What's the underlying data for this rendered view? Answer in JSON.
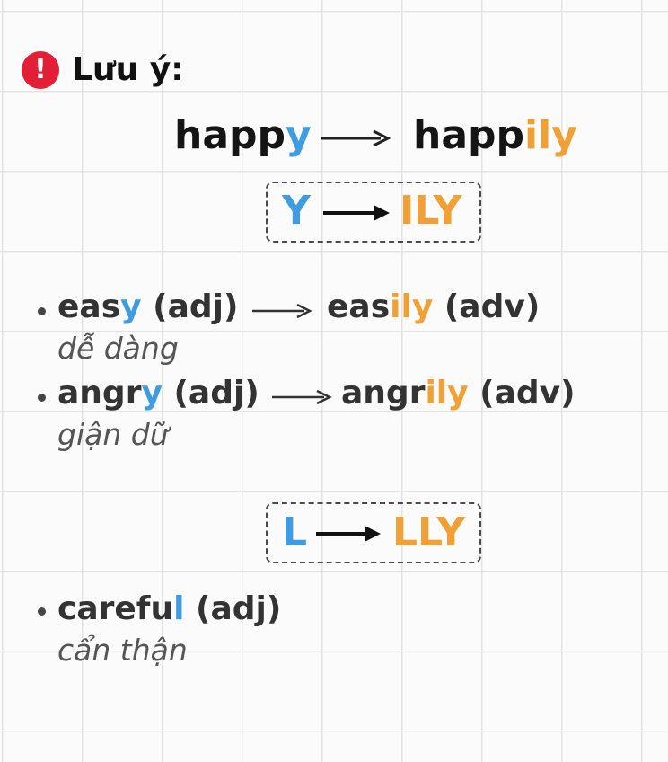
{
  "title": {
    "icon": "exclamation-icon",
    "icon_glyph": "!",
    "text": "Lưu ý:",
    "badge_color": "#e21f36"
  },
  "colors": {
    "removed": "#3f9ce0",
    "added": "#f0a035"
  },
  "main_example": {
    "from_stem": "happ",
    "from_suffix": "y",
    "to_stem": "happ",
    "to_suffix": "ily"
  },
  "rules": [
    {
      "from": "Y",
      "to": "ILY"
    },
    {
      "from": "L",
      "to": "LLY"
    }
  ],
  "examples": [
    {
      "adj_stem": "eas",
      "adj_suffix": "y",
      "adj_tag": "(adj)",
      "adv_stem": "eas",
      "adv_suffix": "ily",
      "adv_tag": "(adv)",
      "meaning": "dễ dàng"
    },
    {
      "adj_stem": "angr",
      "adj_suffix": "y",
      "adj_tag": "(adj)",
      "adv_stem": "angr",
      "adv_suffix": "ily",
      "adv_tag": "(adv)",
      "meaning": "giận dữ"
    },
    {
      "adj_stem": "carefu",
      "adj_suffix": "l",
      "adj_tag": "(adj)",
      "meaning": "cẩn thận"
    }
  ]
}
